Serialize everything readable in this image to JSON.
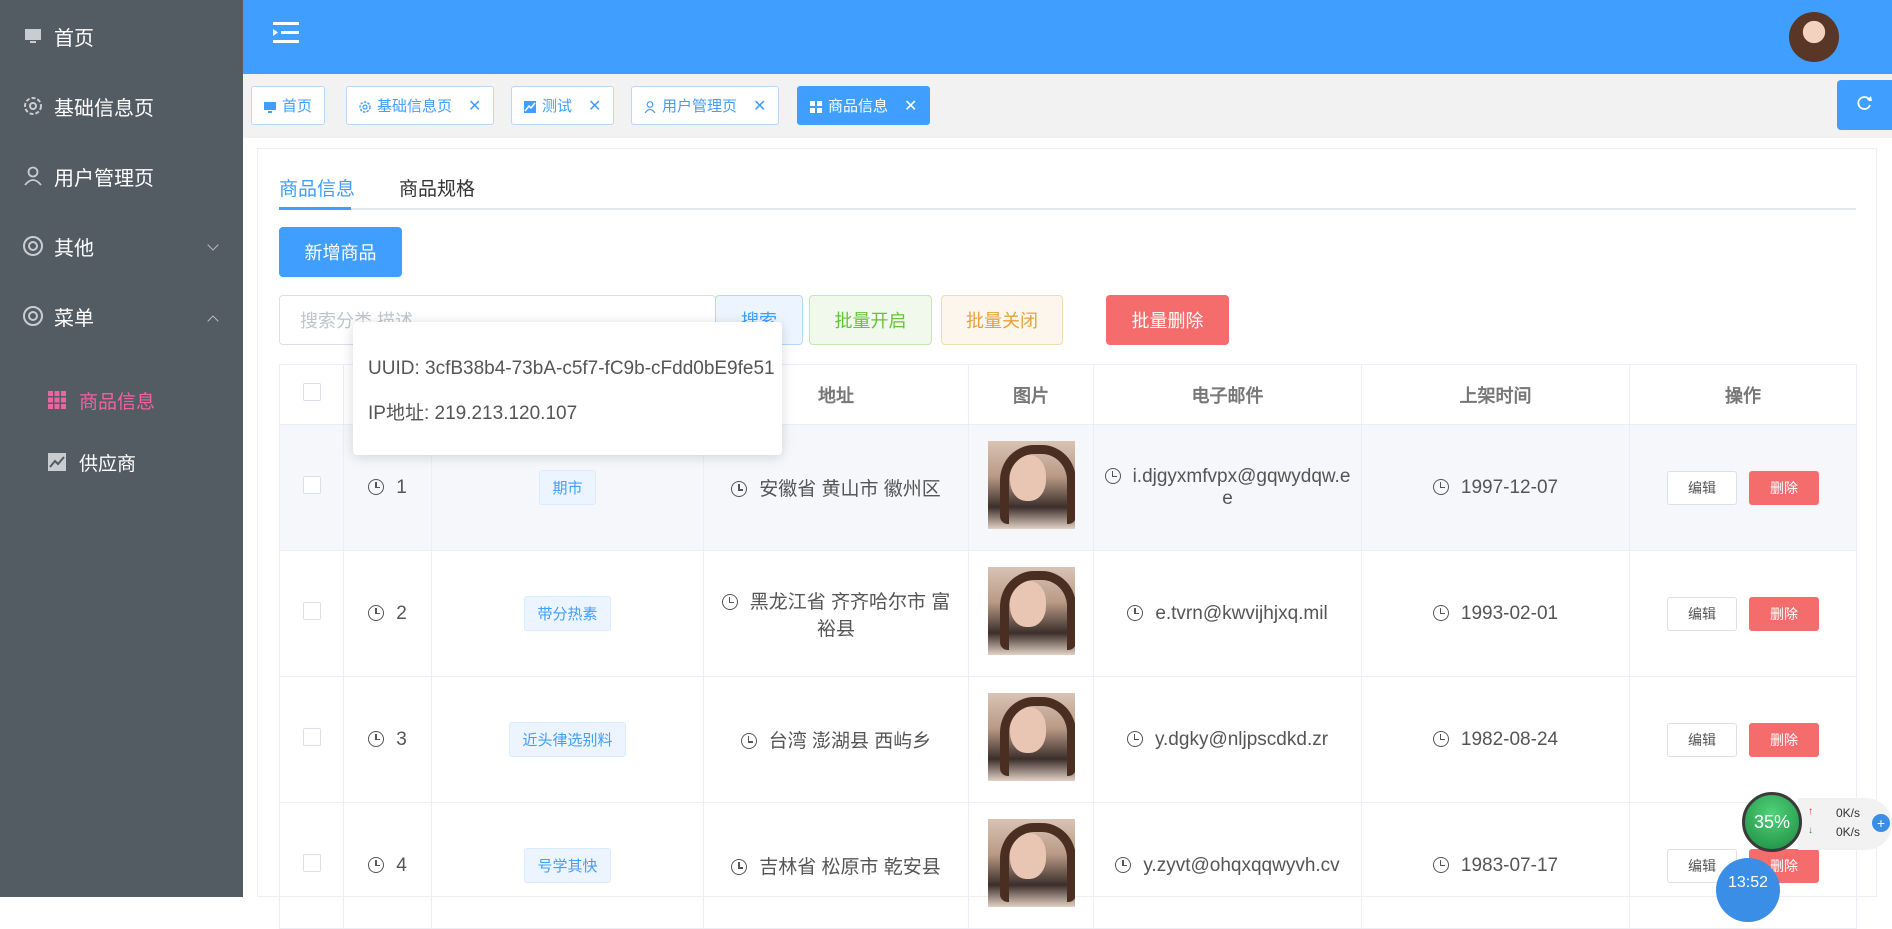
{
  "sidebar": {
    "items": [
      {
        "label": "首页",
        "icon": "monitor-icon"
      },
      {
        "label": "基础信息页",
        "icon": "gear-icon"
      },
      {
        "label": "用户管理页",
        "icon": "user-icon"
      },
      {
        "label": "其他",
        "icon": "lifebuoy-icon"
      },
      {
        "label": "菜单",
        "icon": "lifebuoy-icon"
      }
    ],
    "sub_items": [
      {
        "label": "商品信息",
        "icon": "grid-icon",
        "active": true
      },
      {
        "label": "供应商",
        "icon": "chart-icon"
      }
    ]
  },
  "tabs": [
    {
      "label": "首页"
    },
    {
      "label": "基础信息页"
    },
    {
      "label": "测试"
    },
    {
      "label": "用户管理页"
    },
    {
      "label": "商品信息",
      "active": true
    }
  ],
  "content_tabs": [
    {
      "label": "商品信息",
      "active": true
    },
    {
      "label": "商品规格"
    }
  ],
  "toolbar": {
    "add_label": "新增商品",
    "search_placeholder": "搜索分类 描述",
    "search_label": "搜索",
    "batch_open_label": "批量开启",
    "batch_close_label": "批量关闭",
    "batch_delete_label": "批量删除"
  },
  "table": {
    "headers": [
      "地址",
      "图片",
      "电子邮件",
      "上架时间",
      "操作"
    ],
    "rows": [
      {
        "id": "1",
        "tag": "期市",
        "address": "安徽省 黄山市 徽州区",
        "email": "i.djgyxmfvpx@gqwydqw.ee",
        "date": "1997-12-07"
      },
      {
        "id": "2",
        "tag": "带分热素",
        "address": "黑龙江省 齐齐哈尔市 富裕县",
        "email": "e.tvrn@kwvijhjxq.mil",
        "date": "1993-02-01"
      },
      {
        "id": "3",
        "tag": "近头律选别料",
        "address": "台湾 澎湖县 西屿乡",
        "email": "y.dgky@nljpscdkd.zr",
        "date": "1982-08-24"
      },
      {
        "id": "4",
        "tag": "号学其快",
        "address": "吉林省 松原市 乾安县",
        "email": "y.zyvt@ohqxqqwyvh.cv",
        "date": "1983-07-17"
      }
    ],
    "edit_label": "编辑",
    "delete_label": "删除"
  },
  "tooltip": {
    "uuid": "UUID: 3cfB38b4-73bA-c5f7-fC9b-cFdd0bE9fe51",
    "ip": "IP地址: 219.213.120.107"
  },
  "widget": {
    "percent": "35%",
    "up": "0K/s",
    "down": "0K/s",
    "clock": "13:52"
  },
  "colors": {
    "primary": "#409eff",
    "sidebar": "#535b63",
    "danger": "#f56c6c",
    "success": "#67c23a",
    "warning": "#e6a23c",
    "active_sub": "#f063a3"
  }
}
